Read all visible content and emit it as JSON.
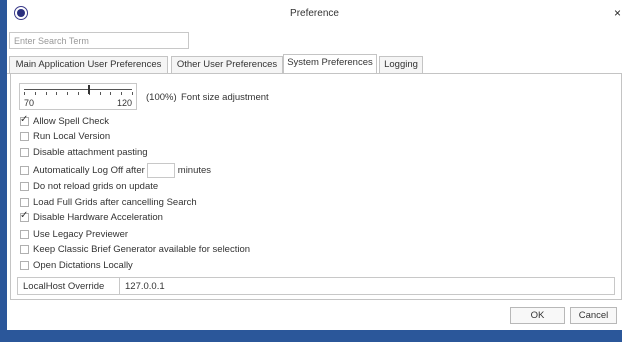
{
  "window": {
    "title": "Preference",
    "close_symbol": "×",
    "icon": "app-logo-icon",
    "frame_color": "#2b579a"
  },
  "search": {
    "placeholder": "Enter Search Term",
    "value": ""
  },
  "tabs": [
    {
      "label": "Main Application User Preferences",
      "active": false
    },
    {
      "label": "Other User Preferences",
      "active": false
    },
    {
      "label": "System Preferences",
      "active": true
    },
    {
      "label": "Logging",
      "active": false
    }
  ],
  "font_size": {
    "slider_min": "70",
    "slider_max": "120",
    "value": 100,
    "percent_label": "(100%)",
    "label": "Font size adjustment"
  },
  "options": [
    {
      "label": "Allow Spell Check",
      "checked": true
    },
    {
      "label": "Run Local Version",
      "checked": false
    },
    {
      "label": "Disable attachment pasting",
      "checked": false
    },
    {
      "label": "Automatically Log Off after",
      "suffix": "minutes",
      "value": "",
      "checked": false
    },
    {
      "label": "Do not reload grids on update",
      "checked": false
    },
    {
      "label": "Load Full Grids after cancelling Search",
      "checked": false
    },
    {
      "label": "Disable Hardware Acceleration",
      "checked": true
    },
    {
      "label": "Use Legacy Previewer",
      "checked": false
    },
    {
      "label": "Keep Classic Brief Generator available for selection",
      "checked": false
    },
    {
      "label": "Open Dictations Locally",
      "checked": false
    }
  ],
  "localhost": {
    "label": "LocalHost Override",
    "value": "127.0.0.1"
  },
  "buttons": {
    "ok": "OK",
    "cancel": "Cancel"
  }
}
